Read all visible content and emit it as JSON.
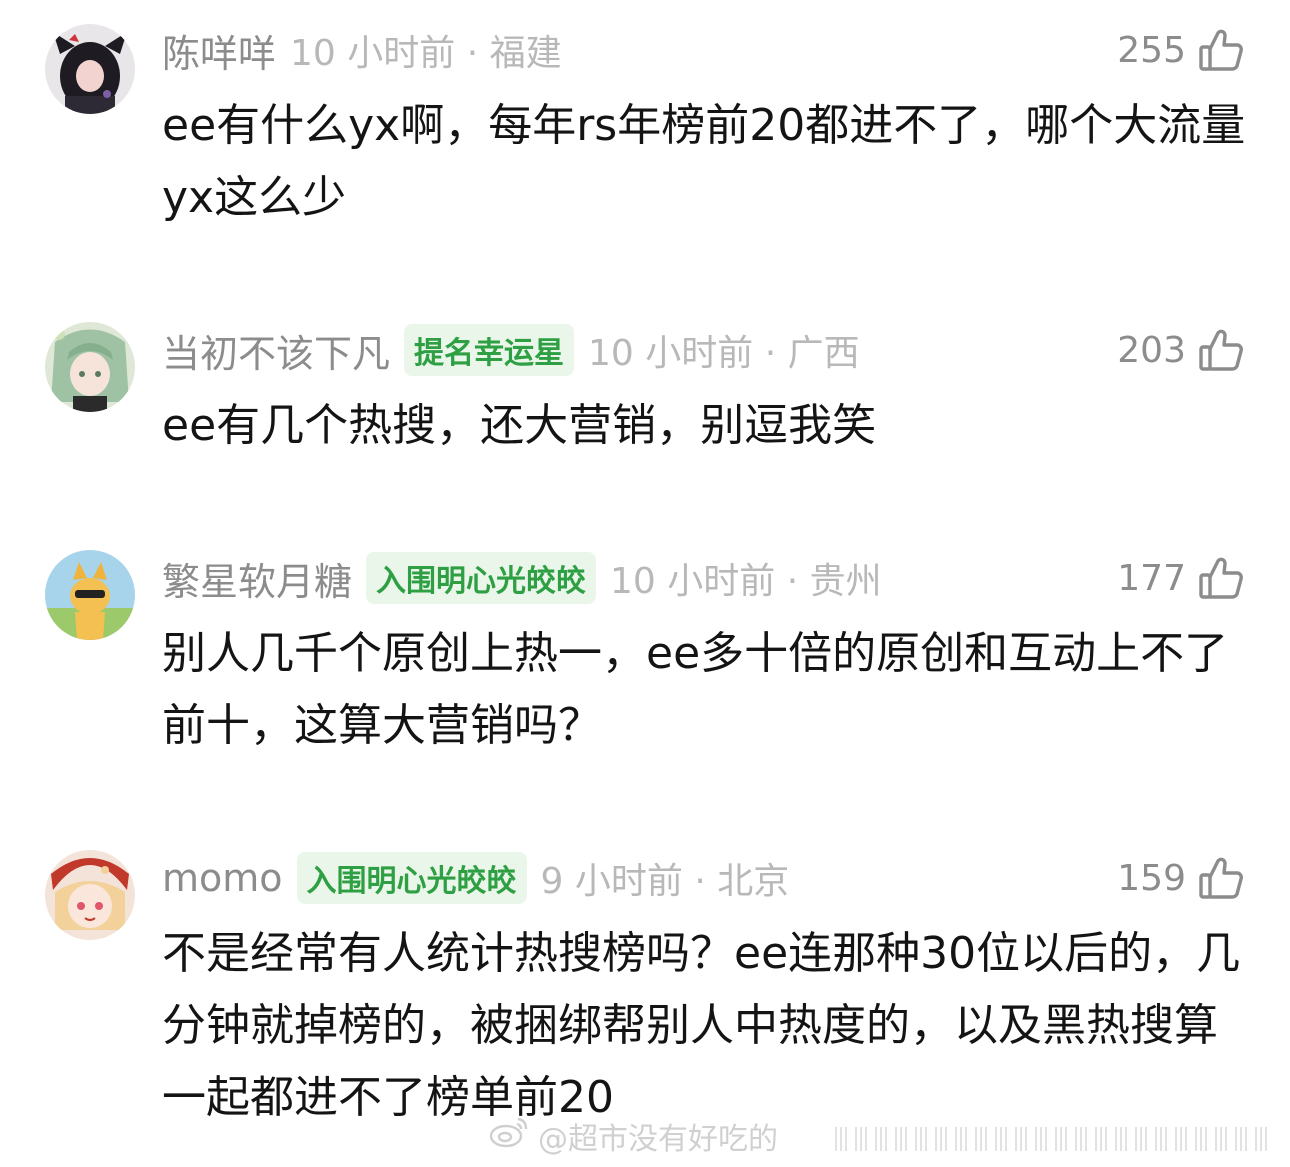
{
  "comments": [
    {
      "username": "陈咩咩",
      "badge": "",
      "meta": "10 小时前 · 福建",
      "likes": "255",
      "text": "ee有什么yx啊，每年rs年榜前20都进不了，哪个大流量yx这么少"
    },
    {
      "username": "当初不该下凡",
      "badge": "提名幸运星",
      "meta": "10 小时前 · 广西",
      "likes": "203",
      "text": "ee有几个热搜，还大营销，别逗我笑"
    },
    {
      "username": "繁星软月糖",
      "badge": "入围明心光皎皎",
      "meta": "10 小时前 · 贵州",
      "likes": "177",
      "text": "别人几千个原创上热一，ee多十倍的原创和互动上不了前十，这算大营销吗？"
    },
    {
      "username": "momo",
      "badge": "入围明心光皎皎",
      "meta": "9 小时前 · 北京",
      "likes": "159",
      "text": "不是经常有人统计热搜榜吗？ee连那种30位以后的，几分钟就掉榜的，被捆绑帮别人中热度的，以及黑热搜算一起都进不了榜单前20"
    }
  ],
  "watermark": "@超市没有好吃的",
  "icons": {
    "like": "thumbs-up-icon",
    "watermark": "weibo-logo-icon"
  }
}
